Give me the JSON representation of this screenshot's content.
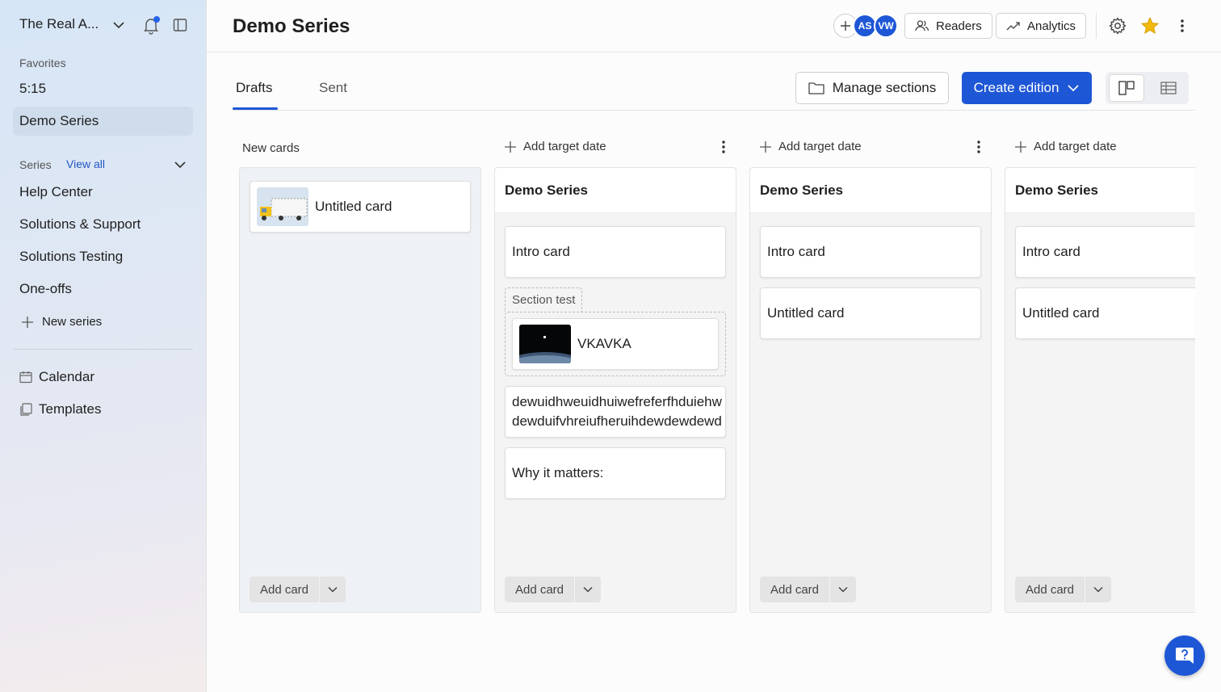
{
  "sidebar": {
    "workspace": "The Real A...",
    "favorites_label": "Favorites",
    "favorites": [
      "5:15",
      "Demo Series"
    ],
    "series_label": "Series",
    "view_all": "View all",
    "series": [
      "Help Center",
      "Solutions & Support",
      "Solutions Testing",
      "One-offs"
    ],
    "new_series": "New series",
    "calendar": "Calendar",
    "templates": "Templates"
  },
  "header": {
    "title": "Demo Series",
    "avatars": [
      "AS",
      "VW"
    ],
    "readers": "Readers",
    "analytics": "Analytics"
  },
  "tabs": [
    "Drafts",
    "Sent"
  ],
  "toolbar": {
    "manage_sections": "Manage sections",
    "create_edition": "Create edition"
  },
  "board": {
    "new_cards_label": "New cards",
    "add_target_date": "Add target date",
    "add_card": "Add card",
    "new_cards": [
      "Untitled card"
    ],
    "editions": [
      {
        "title": "Demo Series",
        "intro": "Intro card",
        "section": "Section test",
        "section_card": "VKAVKA",
        "long_line1": "dewuidhweuidhuiwefreferfhduiehw",
        "long_line2": "dewduifvhreiufheruihdewdewdewd",
        "why": "Why it matters:"
      },
      {
        "title": "Demo Series",
        "intro": "Intro card",
        "card2": "Untitled card"
      },
      {
        "title": "Demo Series",
        "intro": "Intro card",
        "card2": "Untitled card"
      }
    ]
  },
  "colors": {
    "accent": "#1e57d6",
    "star": "#f2b90d"
  }
}
